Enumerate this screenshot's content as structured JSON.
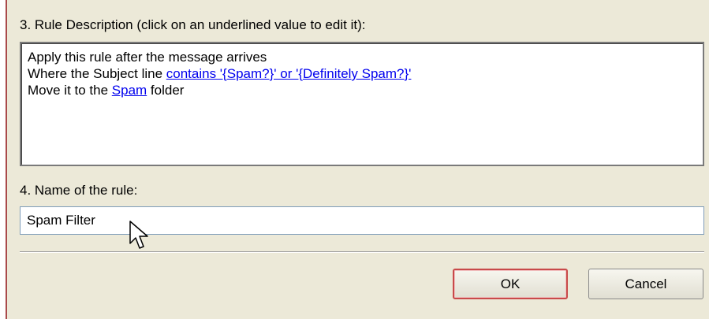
{
  "section3": {
    "label": "3. Rule Description (click on an underlined value to edit it):"
  },
  "description": {
    "line1": "Apply this rule after the message arrives",
    "line2_prefix": "Where the Subject line ",
    "line2_link": "contains '{Spam?}' or '{Definitely Spam?}'",
    "line3_prefix": "Move it to the ",
    "line3_link": "Spam",
    "line3_suffix": " folder"
  },
  "section4": {
    "label": "4. Name of the rule:",
    "value": "Spam Filter"
  },
  "buttons": {
    "ok_label": "OK",
    "cancel_label": "Cancel"
  },
  "icons": {
    "cursor": "arrow-cursor-icon"
  }
}
